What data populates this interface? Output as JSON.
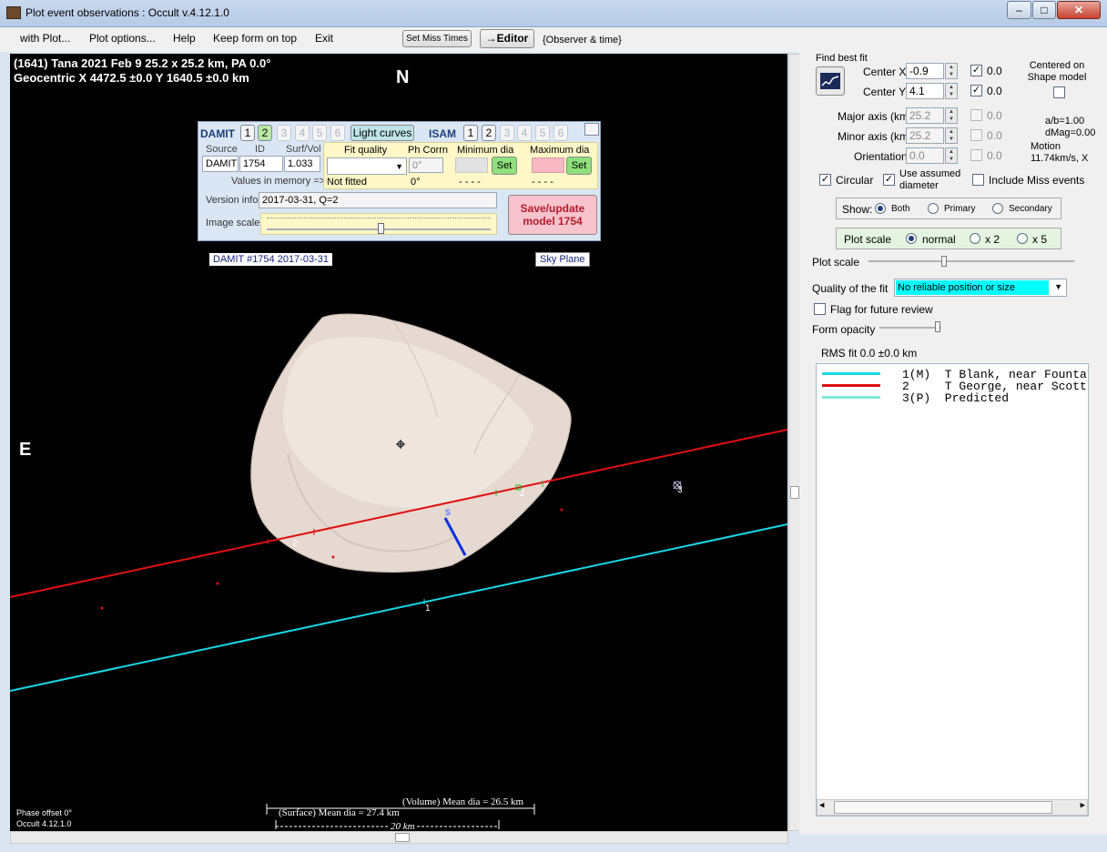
{
  "window": {
    "title": "Plot event observations : Occult v.4.12.1.0",
    "controls": [
      "–",
      "□",
      "✕"
    ]
  },
  "menu": {
    "items": [
      "with Plot...",
      "Plot options...",
      "Help",
      "Keep form on top",
      "Exit"
    ],
    "set_miss_times": "Set Miss Times",
    "editor": "→Editor",
    "observer_time": "{Observer & time}"
  },
  "plot": {
    "header_line1": "(1641) Tana  2021 Feb 9  25.2 x 25.2 km, PA 0.0°",
    "header_line2": "Geocentric X 4472.5 ±0.0  Y 1640.5 ±0.0 km",
    "north": "N",
    "east": "E",
    "damit_tag": "DAMIT #1754 2017-03-31",
    "sky_plane": "Sky Plane",
    "chord_labels": [
      "1",
      "2",
      "2",
      "3"
    ],
    "s_label": "S",
    "volume_label": "(Volume) Mean dia = 26.5 km",
    "surface_label": "(Surface) Mean dia = 27.4 km",
    "scale_label": "20 km",
    "phase_offset": "Phase offset 0°",
    "version": "Occult 4.12.1.0",
    "colors": {
      "chord1": "#18d8e8",
      "chord2": "#e01010",
      "asteroid": "#e8ddd6"
    }
  },
  "damit_panel": {
    "damit_label": "DAMIT",
    "damit_nums": [
      "1",
      "2",
      "3",
      "4",
      "5",
      "6"
    ],
    "light_curves": "Light curves",
    "isam_label": "ISAM",
    "isam_nums": [
      "1",
      "2",
      "3",
      "4",
      "5",
      "6"
    ],
    "source_hdr": "Source",
    "id_hdr": "ID",
    "surfvol_hdr": "Surf/Vol",
    "source": "DAMIT",
    "id": "1754",
    "surfvol": "1.033",
    "values_in_memory": "Values in memory =>",
    "fit_quality_hdr": "Fit quality",
    "ph_corrn_hdr": "Ph Corrn",
    "min_dia_hdr": "Minimum dia",
    "max_dia_hdr": "Maximum dia",
    "ph_corrn_val": "0°",
    "set_label": "Set",
    "not_fitted": "Not fitted",
    "ph_corrn_mem": "0°",
    "min_mem": "- - - -",
    "max_mem": "- - - -",
    "version_info_lbl": "Version info",
    "version_info": "2017-03-31, Q=2",
    "image_scale_lbl": "Image scale",
    "save_update": "Save/update model 1754"
  },
  "fit": {
    "find_best_fit": "Find best fit",
    "center_x_lbl": "Center X",
    "center_x": "-0.9",
    "center_y_lbl": "Center Y",
    "center_y": "4.1",
    "center_x_res": "0.0",
    "center_y_res": "0.0",
    "centered_on": "Centered on Shape model",
    "major_lbl": "Major axis (km)",
    "major": "25.2",
    "minor_lbl": "Minor axis (km)",
    "minor": "25.2",
    "orient_lbl": "Orientation",
    "orient": "0.0",
    "major_res": "0.0",
    "minor_res": "0.0",
    "orient_res": "0.0",
    "ab": "a/b=1.00",
    "dmag": "dMag=0.00",
    "motion": "Motion",
    "motion_val": "11.74km/s, X",
    "circular": "Circular",
    "use_assumed": "Use assumed diameter",
    "include_miss": "Include Miss events",
    "show_lbl": "Show:",
    "show_opts": [
      "Both",
      "Primary",
      "Secondary"
    ],
    "plot_scale_lbl": "Plot scale",
    "plot_scale_opts": [
      "normal",
      "x 2",
      "x 5"
    ],
    "plot_scale_slider": "Plot scale",
    "quality_lbl": "Quality of the fit",
    "quality_val": "No reliable position or size",
    "flag_future": "Flag for future review",
    "form_opacity": "Form opacity",
    "rms_fit": "RMS fit 0.0 ±0.0 km"
  },
  "legend": {
    "rows": [
      {
        "text": "1(M)  T Blank, near Founta",
        "color": "#18d8e8"
      },
      {
        "text": "2     T George, near Scott",
        "color": "#e01010"
      },
      {
        "text": "3(P)  Predicted",
        "color": "#7fe8d8"
      }
    ]
  }
}
